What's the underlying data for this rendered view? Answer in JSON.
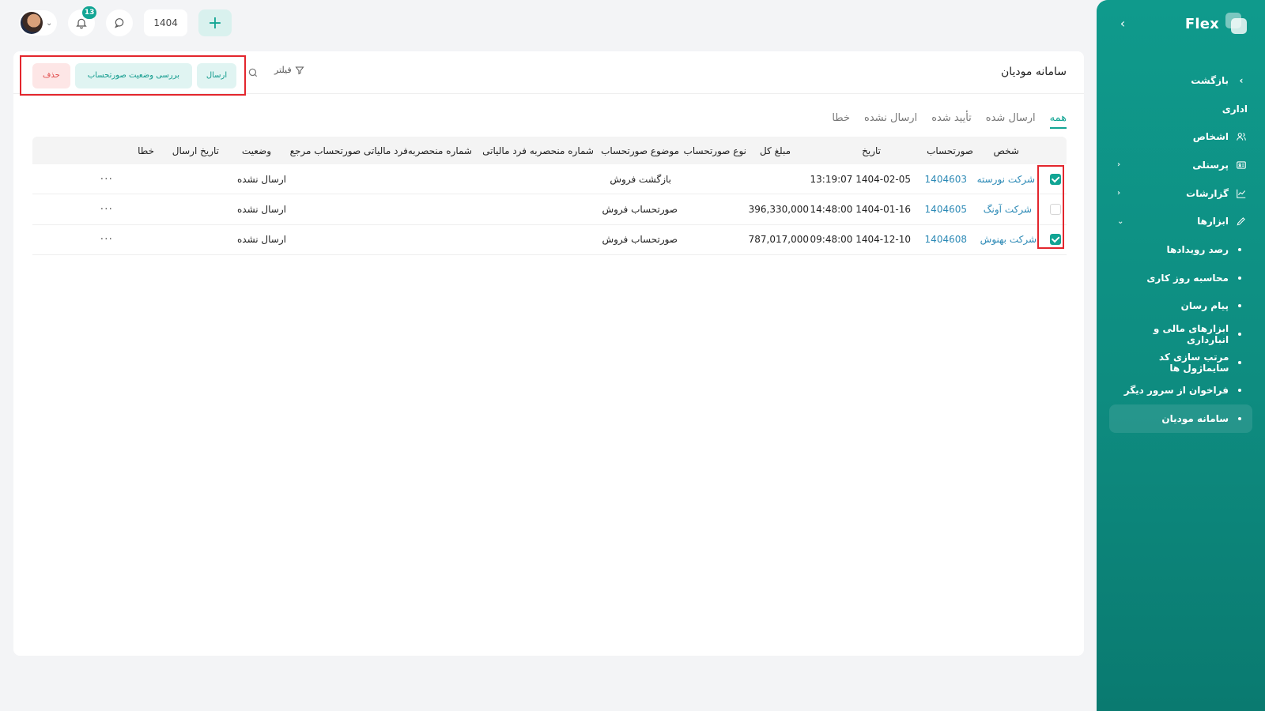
{
  "sidebar": {
    "brand": "Flex",
    "items": [
      {
        "label": "بازگشت",
        "type": "back"
      },
      {
        "label": "اداری",
        "type": "section"
      },
      {
        "label": "اشخاص",
        "icon": "people-icon",
        "type": "item"
      },
      {
        "label": "پرسنلی",
        "icon": "id-card-icon",
        "type": "expandable"
      },
      {
        "label": "گزارشات",
        "icon": "chart-icon",
        "type": "expandable"
      },
      {
        "label": "ابزارها",
        "icon": "pencil-icon",
        "type": "expanded"
      },
      {
        "label": "رصد رویدادها",
        "type": "sub"
      },
      {
        "label": "محاسبه روز کاری",
        "type": "sub"
      },
      {
        "label": "پیام رسان",
        "type": "sub"
      },
      {
        "label": "ابزارهای مالی و انبارداری",
        "type": "sub"
      },
      {
        "label": "مرتب سازی کد سایماژول ها",
        "type": "sub"
      },
      {
        "label": "فراخوان از سرور دیگر",
        "type": "sub"
      },
      {
        "label": "سامانه مودیان",
        "type": "sub-active"
      }
    ]
  },
  "topbar": {
    "notification_count": "13",
    "year": "1404"
  },
  "page": {
    "title": "سامانه مودیان",
    "filter_label": "فیلتر",
    "actions": {
      "send": "ارسال",
      "check_status": "بررسی وضعیت صورتحساب",
      "delete": "حذف"
    },
    "tabs": [
      "همه",
      "ارسال شده",
      "تأیید شده",
      "ارسال نشده",
      "خطا"
    ],
    "active_tab": "همه"
  },
  "table": {
    "columns": {
      "person": "شخص",
      "invoice": "صورتحساب",
      "date": "تاریخ",
      "total": "مبلغ کل",
      "invoice_type": "نوع صورتحساب",
      "invoice_subject": "موضوع صورتحساب",
      "unique_tax_id": "شماره منحصربه فرد مالیاتی",
      "ref_unique_tax_id": "شماره منحصربه‌فرد مالیاتی صورتحساب مرجع",
      "status": "وضعیت",
      "send_date": "تاریخ ارسال",
      "error": "خطا"
    },
    "rows": [
      {
        "checked": true,
        "person": "شرکت نورسته",
        "invoice": "1404603",
        "date": "1404-02-05 13:19:07",
        "total": "",
        "invoice_type": "",
        "invoice_subject": "بازگشت فروش",
        "status": "ارسال نشده",
        "more": "···"
      },
      {
        "checked": false,
        "person": "شرکت آونگ",
        "invoice": "1404605",
        "date": "1404-01-16 14:48:00",
        "total": "396,330,000",
        "invoice_type": "",
        "invoice_subject": "صورتحساب فروش",
        "status": "ارسال نشده",
        "more": "···"
      },
      {
        "checked": true,
        "person": "شرکت بهنوش",
        "invoice": "1404608",
        "date": "1404-12-10 09:48:00",
        "total": "787,017,000",
        "invoice_type": "",
        "invoice_subject": "صورتحساب فروش",
        "status": "ارسال نشده",
        "more": "···"
      }
    ]
  }
}
